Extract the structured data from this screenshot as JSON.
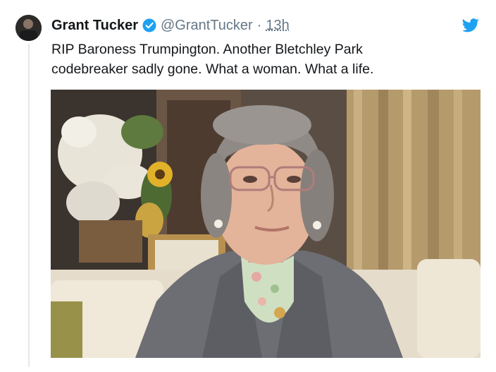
{
  "tweet": {
    "author_name": "Grant Tucker",
    "handle": "@GrantTucker",
    "separator": "·",
    "time": "13h",
    "text_line1": "RIP Baroness Trumpington. Another Bletchley Park",
    "text_line2": "codebreaker sadly gone. What a woman. What a life."
  },
  "icons": {
    "verified": "verified-badge-icon",
    "platform": "twitter-bird-icon"
  },
  "colors": {
    "brand_blue": "#1da1f2",
    "text_primary": "#14171a",
    "text_secondary": "#657786"
  }
}
